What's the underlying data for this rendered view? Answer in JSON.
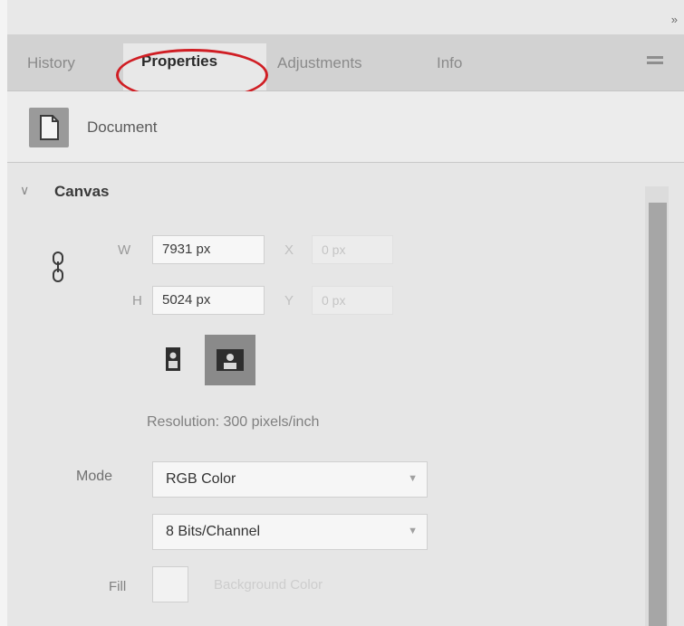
{
  "panel": {
    "collapse_glyph": "»",
    "tabs": [
      "History",
      "Properties",
      "Adjustments",
      "Info"
    ],
    "active_tab": "Properties",
    "highlight_color": "#d01e24"
  },
  "document": {
    "label": "Document",
    "icon": "document-icon"
  },
  "canvas": {
    "title": "Canvas",
    "width_label": "W",
    "width_value": "7931 px",
    "height_label": "H",
    "height_value": "5024 px",
    "x_label": "X",
    "x_value": "0 px",
    "y_label": "Y",
    "y_value": "0 px",
    "orientation_selected": "landscape",
    "resolution": "Resolution: 300 pixels/inch",
    "mode_label": "Mode",
    "mode_value": "RGB Color",
    "depth_value": "8 Bits/Channel",
    "fill_label": "Fill",
    "fill_value": "Background Color"
  }
}
